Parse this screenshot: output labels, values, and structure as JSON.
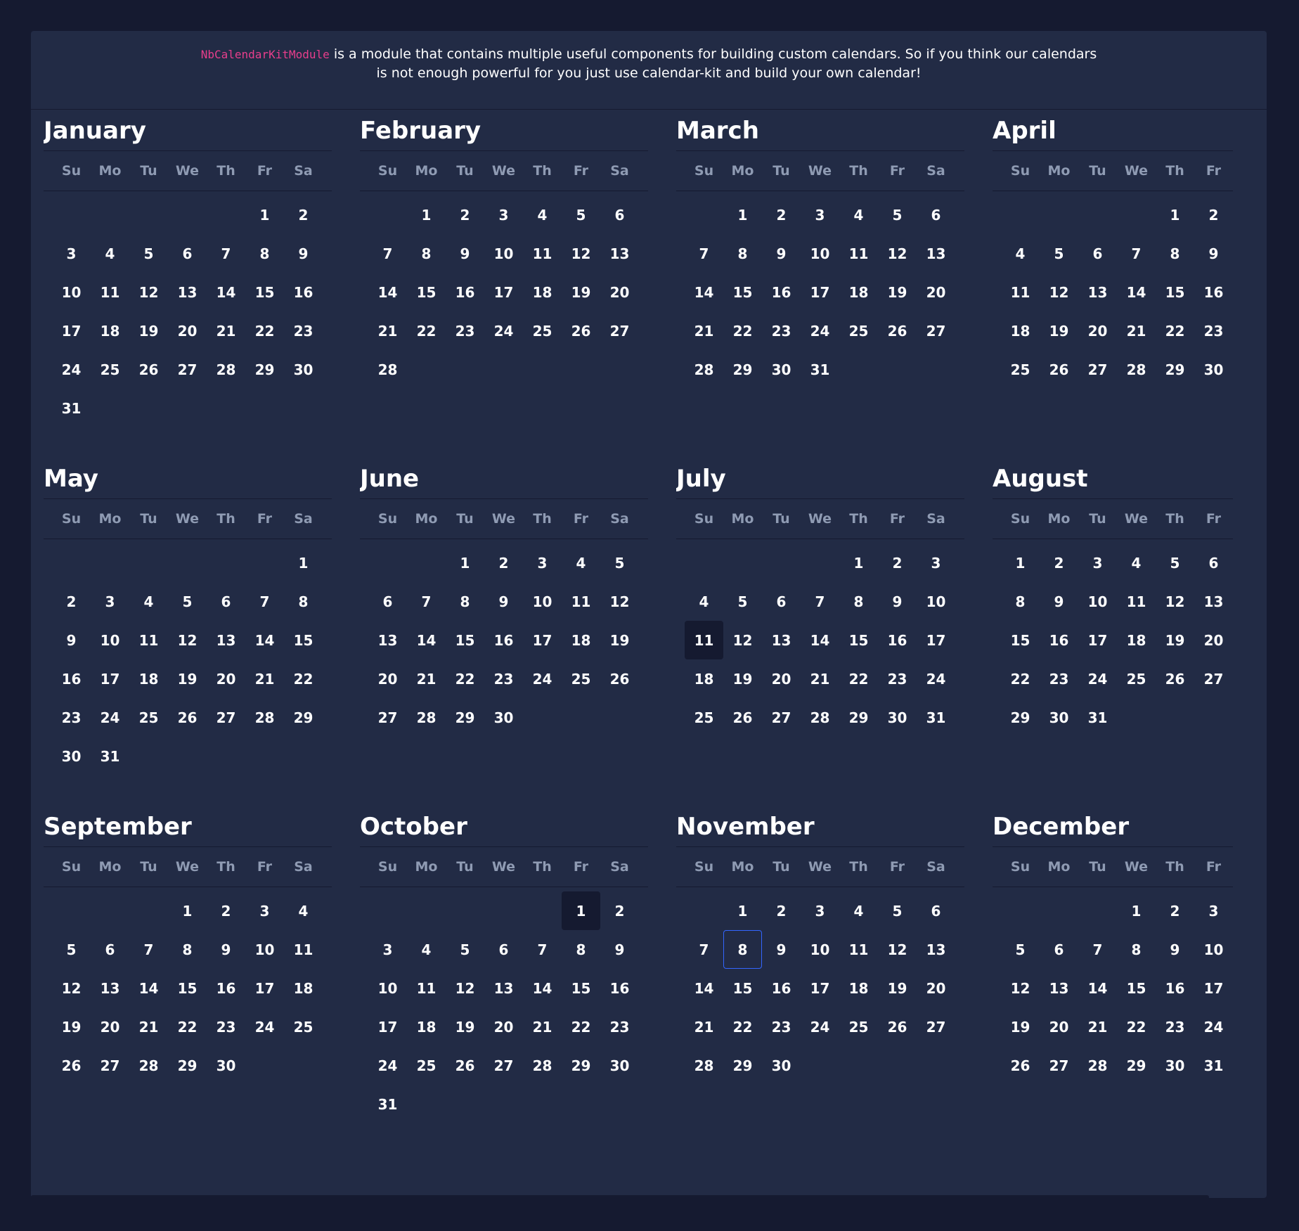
{
  "header": {
    "module_name": "NbCalendarKitModule",
    "description": "is a module that contains multiple useful components for building custom calendars. So if you think our calendars is not enough powerful for you just use calendar-kit and build your own calendar!"
  },
  "day_names": [
    "Su",
    "Mo",
    "Tu",
    "We",
    "Th",
    "Fr",
    "Sa"
  ],
  "highlighted": [
    {
      "month": 6,
      "day": 11
    },
    {
      "month": 9,
      "day": 1
    }
  ],
  "selected": {
    "month": 10,
    "day": 8
  },
  "months": [
    {
      "name": "January",
      "start": 5,
      "days": 31
    },
    {
      "name": "February",
      "start": 1,
      "days": 28
    },
    {
      "name": "March",
      "start": 1,
      "days": 31
    },
    {
      "name": "April",
      "start": 4,
      "days": 30
    },
    {
      "name": "May",
      "start": 6,
      "days": 31
    },
    {
      "name": "June",
      "start": 2,
      "days": 30
    },
    {
      "name": "July",
      "start": 4,
      "days": 31
    },
    {
      "name": "August",
      "start": 0,
      "days": 31
    },
    {
      "name": "September",
      "start": 3,
      "days": 30
    },
    {
      "name": "October",
      "start": 5,
      "days": 31
    },
    {
      "name": "November",
      "start": 1,
      "days": 30
    },
    {
      "name": "December",
      "start": 3,
      "days": 31
    }
  ]
}
